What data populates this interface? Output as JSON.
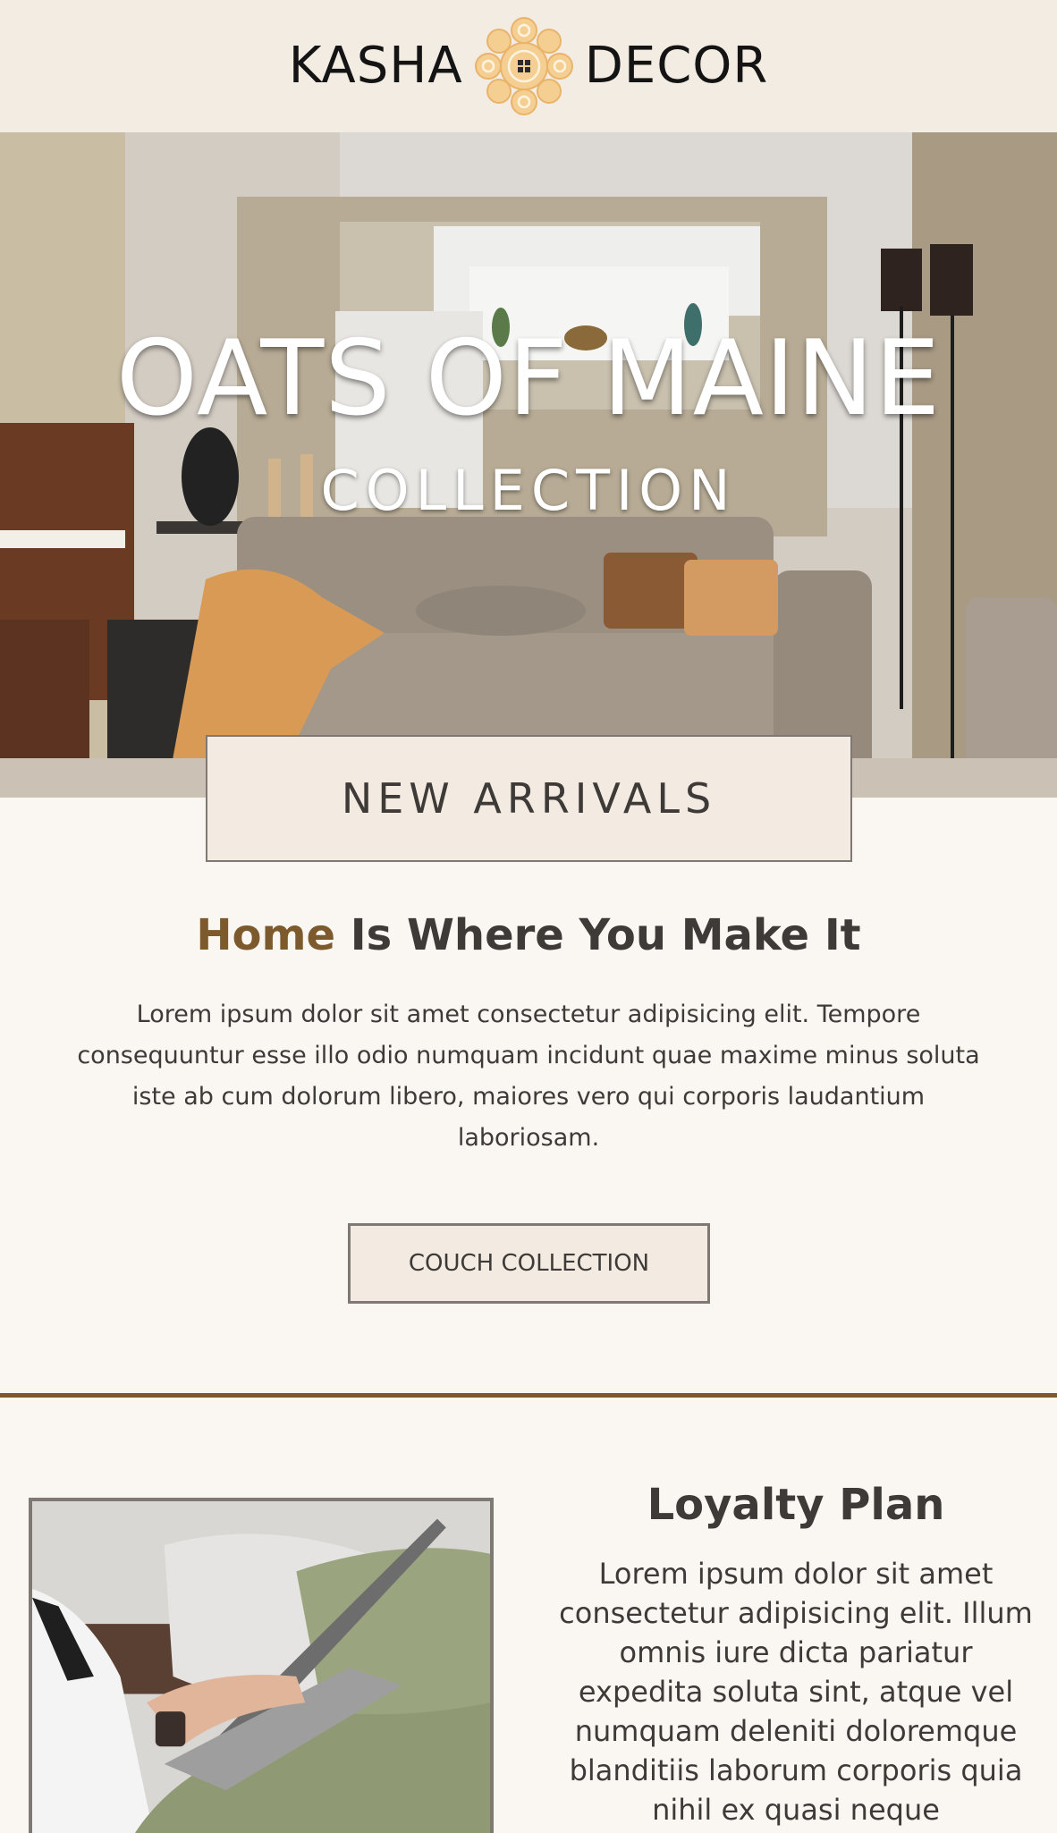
{
  "brand": {
    "name_left": "KASHA",
    "name_right": "DECOR",
    "logo_icon": "ornament-knot-icon",
    "logo_color": "#f2c88a"
  },
  "hero": {
    "title": "OATS OF MAINE",
    "subtitle": "COLLECTION",
    "image": "living-room-sofa-photo",
    "badge_label": "NEW ARRIVALS"
  },
  "intro": {
    "title_accent": "Home",
    "title_rest": " Is Where You Make It",
    "body": "Lorem ipsum dolor sit amet consectetur adipisicing elit. Tempore consequuntur esse illo odio numquam incidunt quae maxime minus soluta iste ab cum dolorum libero, maiores vero qui corporis laudantium laboriosam.",
    "cta_label": "COUCH COLLECTION"
  },
  "loyalty": {
    "title": "Loyalty Plan",
    "body": "Lorem ipsum dolor sit amet consectetur adipisicing elit. Illum omnis iure dicta pariatur expedita soluta sint, atque vel numquam deleniti doloremque blanditiis laborum corporis quia nihil ex quasi neque",
    "image": "person-with-laptop-photo"
  },
  "colors": {
    "header_bg": "#f3ece3",
    "page_bg": "#faf7f2",
    "accent": "#7c5a2e",
    "text": "#3d3a37",
    "border": "#7f7873"
  }
}
